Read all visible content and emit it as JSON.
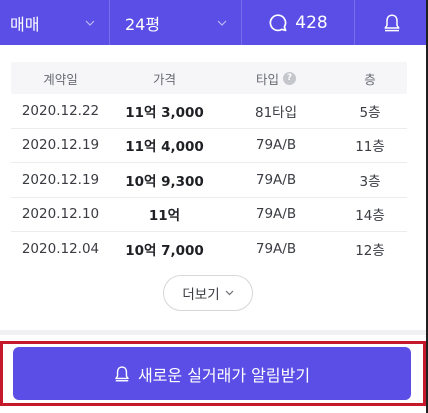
{
  "nav": {
    "deal_type": "매매",
    "size": "24평",
    "comment_count": "428"
  },
  "table": {
    "headers": {
      "date": "계약일",
      "price": "가격",
      "type": "타입",
      "floor": "층"
    },
    "rows": [
      {
        "date": "2020.12.22",
        "price": "11억 3,000",
        "type": "81타입",
        "floor": "5층"
      },
      {
        "date": "2020.12.19",
        "price": "11억 4,000",
        "type": "79A/B",
        "floor": "11층"
      },
      {
        "date": "2020.12.19",
        "price": "10억 9,300",
        "type": "79A/B",
        "floor": "3층"
      },
      {
        "date": "2020.12.10",
        "price": "11억",
        "type": "79A/B",
        "floor": "14층"
      },
      {
        "date": "2020.12.04",
        "price": "10억 7,000",
        "type": "79A/B",
        "floor": "12층"
      }
    ]
  },
  "more": {
    "label": "더보기"
  },
  "alert": {
    "label": "새로운 실거래가 알림받기"
  },
  "colors": {
    "primary": "#5a4ee6",
    "highlight_border": "#c5182b"
  },
  "icons": {
    "deal_chevron": "chevron-down-icon",
    "size_chevron": "chevron-down-icon",
    "comment": "comment-bubble-icon",
    "bell": "bell-icon",
    "help": "question-circle-icon",
    "more_chevron": "chevron-down-icon"
  }
}
